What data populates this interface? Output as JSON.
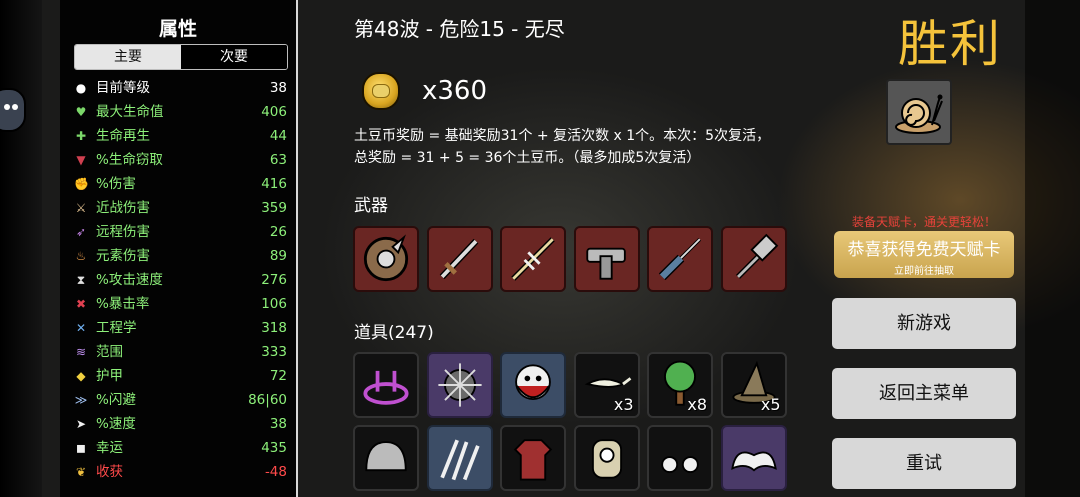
{
  "stats_panel": {
    "title": "属性",
    "tabs": [
      {
        "label": "主要",
        "active": true
      },
      {
        "label": "次要",
        "active": false
      }
    ],
    "rows": [
      {
        "icon": "level-icon",
        "glyph": "●",
        "label": "目前等级",
        "value": "38",
        "label_color": "#ffffff",
        "value_color": "#ffffff",
        "icon_color": "#ffffff"
      },
      {
        "icon": "heart-icon",
        "glyph": "♥",
        "label": "最大生命值",
        "value": "406",
        "label_color": "#8df07a",
        "value_color": "#8df07a",
        "icon_color": "#7cd86a"
      },
      {
        "icon": "regen-icon",
        "glyph": "✚",
        "label": "生命再生",
        "value": "44",
        "label_color": "#8df07a",
        "value_color": "#8df07a",
        "icon_color": "#7cd86a"
      },
      {
        "icon": "lifesteal-icon",
        "glyph": "▼",
        "label": "%生命窃取",
        "value": "63",
        "label_color": "#8df07a",
        "value_color": "#8df07a",
        "icon_color": "#d04050"
      },
      {
        "icon": "damage-icon",
        "glyph": "✊",
        "label": "%伤害",
        "value": "416",
        "label_color": "#8df07a",
        "value_color": "#8df07a",
        "icon_color": "#e06070"
      },
      {
        "icon": "melee-icon",
        "glyph": "⚔",
        "label": "近战伤害",
        "value": "359",
        "label_color": "#8df07a",
        "value_color": "#8df07a",
        "icon_color": "#e0c090"
      },
      {
        "icon": "ranged-icon",
        "glyph": "➶",
        "label": "远程伤害",
        "value": "26",
        "label_color": "#8df07a",
        "value_color": "#8df07a",
        "icon_color": "#c080e0"
      },
      {
        "icon": "elemental-icon",
        "glyph": "♨",
        "label": "元素伤害",
        "value": "89",
        "label_color": "#8df07a",
        "value_color": "#8df07a",
        "icon_color": "#f0a050"
      },
      {
        "icon": "attack-speed-icon",
        "glyph": "⧗",
        "label": "%攻击速度",
        "value": "276",
        "label_color": "#8df07a",
        "value_color": "#8df07a",
        "icon_color": "#e0e0e0"
      },
      {
        "icon": "crit-icon",
        "glyph": "✖",
        "label": "%暴击率",
        "value": "106",
        "label_color": "#8df07a",
        "value_color": "#8df07a",
        "icon_color": "#e04050"
      },
      {
        "icon": "engineering-icon",
        "glyph": "✕",
        "label": "工程学",
        "value": "318",
        "label_color": "#8df07a",
        "value_color": "#8df07a",
        "icon_color": "#70b0f0"
      },
      {
        "icon": "range-icon",
        "glyph": "≋",
        "label": "范围",
        "value": "333",
        "label_color": "#8df07a",
        "value_color": "#8df07a",
        "icon_color": "#c090f0"
      },
      {
        "icon": "armor-icon",
        "glyph": "◆",
        "label": "护甲",
        "value": "72",
        "label_color": "#8df07a",
        "value_color": "#8df07a",
        "icon_color": "#f0d040"
      },
      {
        "icon": "dodge-icon",
        "glyph": "≫",
        "label": "%闪避",
        "value": "86|60",
        "label_color": "#8df07a",
        "value_color": "#8df07a",
        "icon_color": "#a0c0f0"
      },
      {
        "icon": "speed-icon",
        "glyph": "➤",
        "label": "%速度",
        "value": "38",
        "label_color": "#8df07a",
        "value_color": "#8df07a",
        "icon_color": "#f0f0f0"
      },
      {
        "icon": "luck-icon",
        "glyph": "◼",
        "label": "幸运",
        "value": "435",
        "label_color": "#8df07a",
        "value_color": "#8df07a",
        "icon_color": "#f0f0f0"
      },
      {
        "icon": "harvest-icon",
        "glyph": "❦",
        "label": "收获",
        "value": "-48",
        "label_color": "#ff4a4a",
        "value_color": "#ff4a4a",
        "icon_color": "#f0c040"
      }
    ]
  },
  "run": {
    "wave_title": "第48波 - 危险15 - 无尽",
    "coins": "x360",
    "reward_line1": "土豆币奖励 = 基础奖励31个 + 复活次数 x 1个。本次：5次复活，",
    "reward_line2": "总奖励 = 31 + 5 = 36个土豆币。（最多加成5次复活）"
  },
  "weapons": {
    "label": "武器",
    "items": [
      {
        "icon": "shield-weapon-icon"
      },
      {
        "icon": "sword-icon"
      },
      {
        "icon": "jousting-lance-icon"
      },
      {
        "icon": "wrench-icon"
      },
      {
        "icon": "screwdriver-icon"
      },
      {
        "icon": "hammer-icon"
      }
    ]
  },
  "items": {
    "label": "道具(247)",
    "row1": [
      {
        "icon": "magic-circle-icon",
        "tier": "item",
        "count": ""
      },
      {
        "icon": "spiked-ball-icon",
        "tier": "rare",
        "count": ""
      },
      {
        "icon": "bearded-face-icon",
        "tier": "blue",
        "count": ""
      },
      {
        "icon": "lizard-icon",
        "tier": "item",
        "count": "x3"
      },
      {
        "icon": "tree-icon",
        "tier": "item",
        "count": "x8"
      },
      {
        "icon": "witch-hat-icon",
        "tier": "item",
        "count": "x5"
      }
    ],
    "row2": [
      {
        "icon": "helmet-icon",
        "tier": "item",
        "count": ""
      },
      {
        "icon": "claw-icon",
        "tier": "blue",
        "count": ""
      },
      {
        "icon": "plaid-shirt-icon",
        "tier": "item",
        "count": ""
      },
      {
        "icon": "cyclops-icon",
        "tier": "item",
        "count": ""
      },
      {
        "icon": "glasses-icon",
        "tier": "item",
        "count": ""
      },
      {
        "icon": "angel-wings-icon",
        "tier": "rare",
        "count": ""
      }
    ]
  },
  "result": {
    "title": "胜利",
    "character_icon": "snail-icon"
  },
  "promo": {
    "title": "装备天赋卡，通关更轻松！",
    "main": "恭喜获得免费天赋卡",
    "sub": "立即前往抽取"
  },
  "buttons": {
    "new_game": "新游戏",
    "main_menu": "返回主菜单",
    "retry": "重试"
  },
  "colors": {
    "accent_gold": "#f5c33b",
    "stat_green": "#8df07a",
    "stat_negative": "#ff4a4a",
    "promo_red": "#e6423a"
  }
}
